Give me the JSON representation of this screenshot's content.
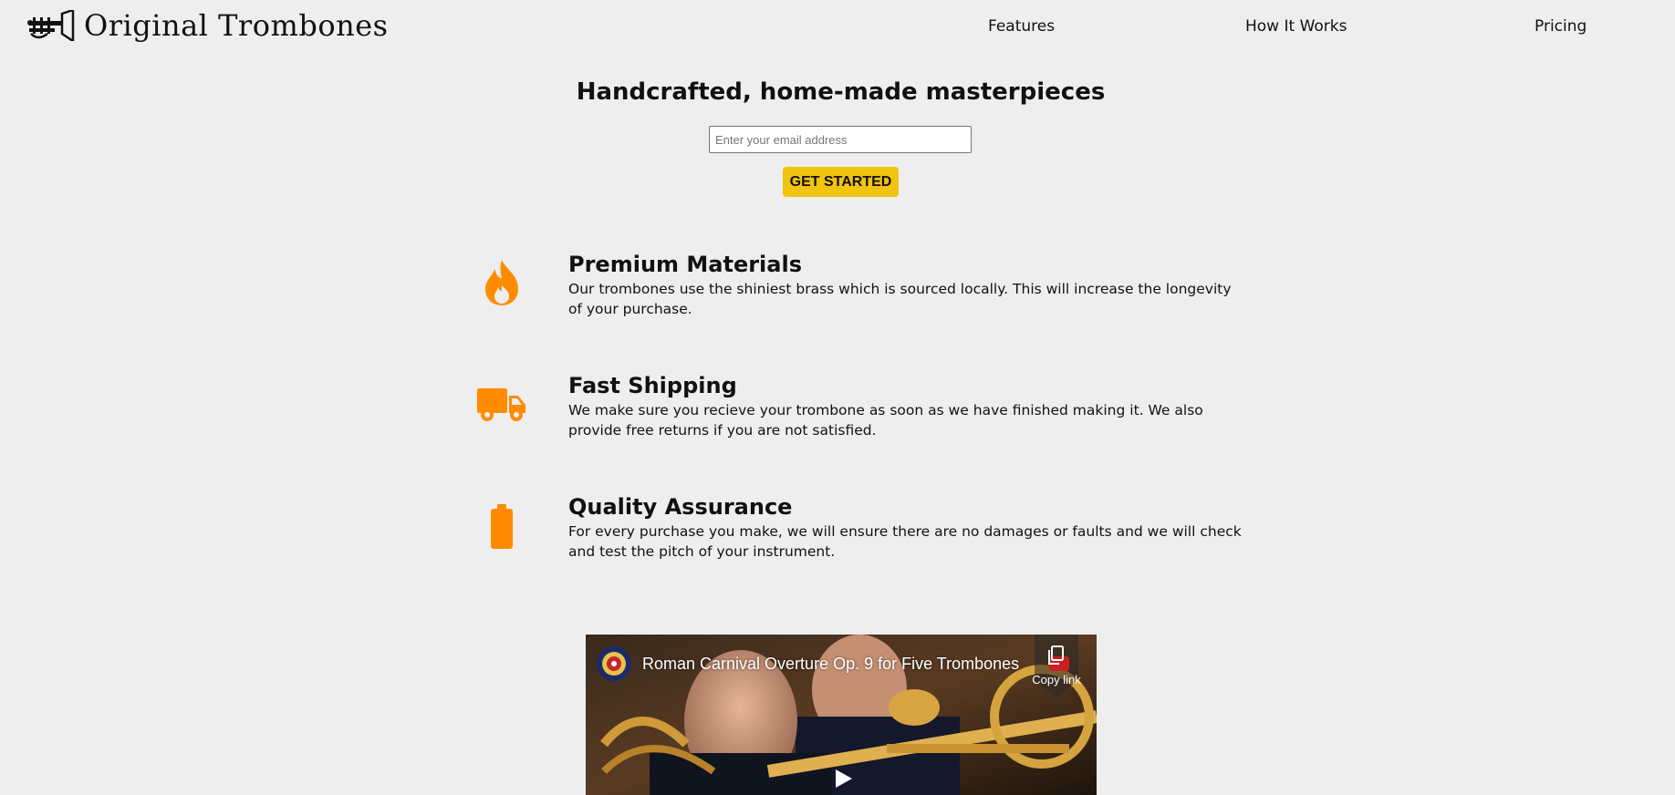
{
  "header": {
    "logo_text": "Original Trombones",
    "logo_icon": "trombone-icon",
    "nav": [
      {
        "label": "Features"
      },
      {
        "label": "How It Works"
      },
      {
        "label": "Pricing"
      }
    ]
  },
  "hero": {
    "title": "Handcrafted, home-made masterpieces",
    "email_placeholder": "Enter your email address",
    "email_value": "",
    "cta_label": "GET STARTED"
  },
  "features": [
    {
      "icon": "fire-icon",
      "title": "Premium Materials",
      "description": "Our trombones use the shiniest brass which is sourced locally. This will increase the longevity of your purchase."
    },
    {
      "icon": "truck-icon",
      "title": "Fast Shipping",
      "description": "We make sure you recieve your trombone as soon as we have finished making it. We also provide free returns if you are not satisfied."
    },
    {
      "icon": "battery-icon",
      "title": "Quality Assurance",
      "description": "For every purchase you make, we will ensure there are no damages or faults and we will check and test the pitch of your instrument."
    }
  ],
  "video": {
    "title": "Roman Carnival Overture Op. 9 for Five Trombones",
    "copy_link_label": "Copy link"
  },
  "colors": {
    "background": "#eeeeee",
    "accent_orange": "#ff8c00",
    "cta_yellow": "#f1c40f",
    "text": "#111111"
  }
}
